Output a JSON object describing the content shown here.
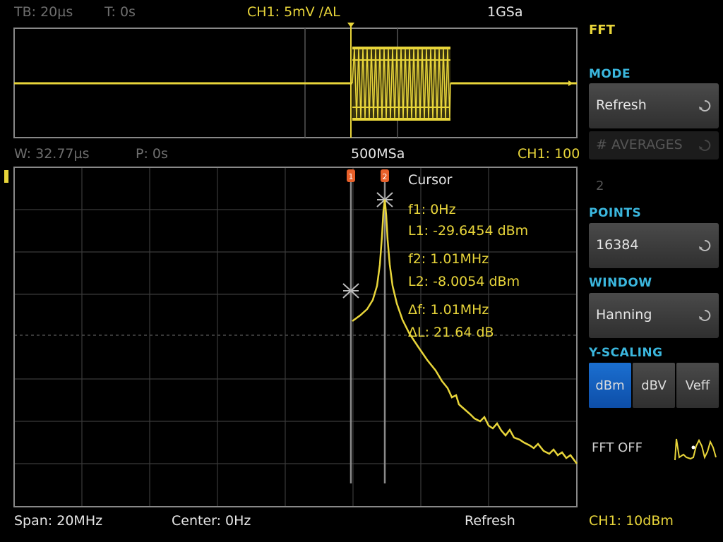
{
  "top_bar": {
    "timebase": "TB: 20µs",
    "trigger_time": "T: 0s",
    "channel": "CH1: 5mV /AL",
    "sample_rate": "1GSa"
  },
  "fft_bar": {
    "window_width": "W: 32.77µs",
    "position": "P: 0s",
    "sample_rate": "500MSa",
    "channel_ref": "CH1: 100"
  },
  "cursor": {
    "title": "Cursor",
    "f1": "f1: 0Hz",
    "l1": "L1: -29.6454 dBm",
    "f2": "f2: 1.01MHz",
    "l2": "L2: -8.0054 dBm",
    "df": "Δf: 1.01MHz",
    "dl": "ΔL: 21.64 dB",
    "marker1": "1",
    "marker2": "2"
  },
  "bottom_bar": {
    "span": "Span: 20MHz",
    "center": "Center: 0Hz",
    "mode": "Refresh",
    "scale": "CH1: 10dBm"
  },
  "side_panel": {
    "title": "FFT",
    "mode_label": "MODE",
    "mode_value": "Refresh",
    "averages_label": "# AVERAGES",
    "averages_value": "2",
    "points_label": "POINTS",
    "points_value": "16384",
    "window_label": "WINDOW",
    "window_value": "Hanning",
    "yscaling_label": "Y-SCALING",
    "yscaling_options": [
      "dBm",
      "dBV",
      "Veff"
    ],
    "yscaling_selected": "dBm",
    "fft_off_label": "FFT OFF"
  },
  "colors": {
    "trace": "#e8d53a",
    "accent_label": "#3bb7de",
    "selected_button": "#1b6fd0",
    "cursor_marker": "#e8602a"
  }
}
